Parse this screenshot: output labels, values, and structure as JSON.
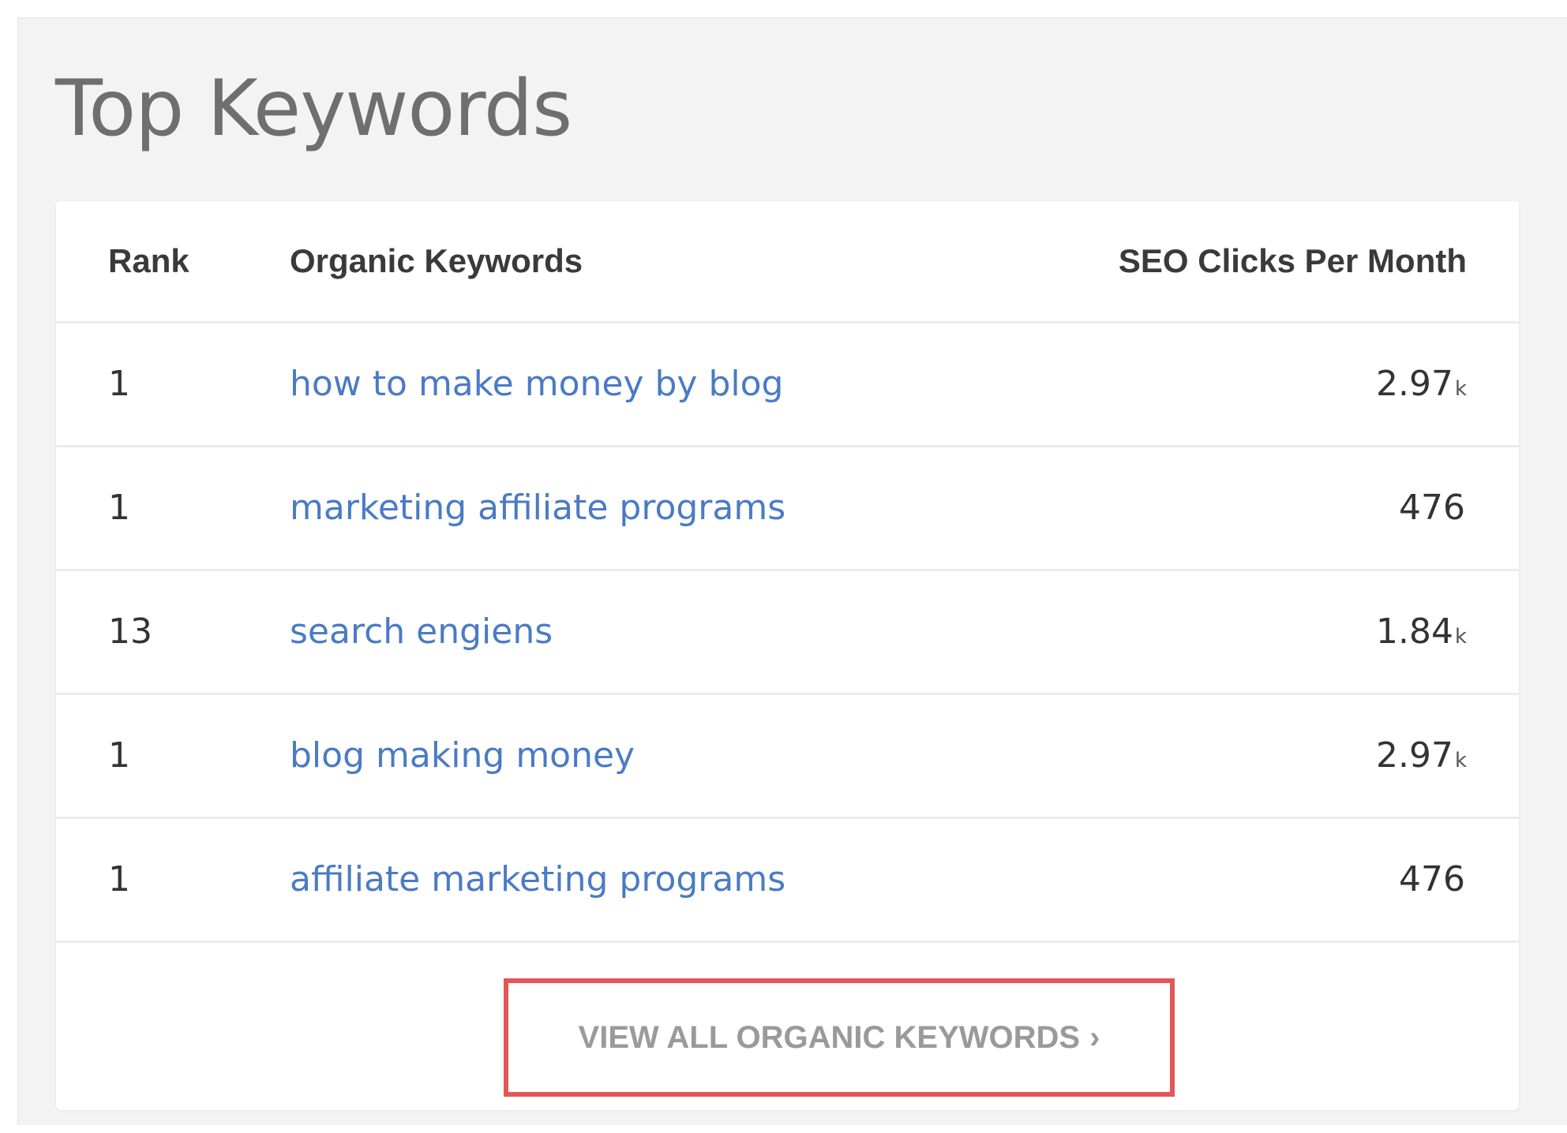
{
  "widget": {
    "title": "Top Keywords"
  },
  "table": {
    "headers": {
      "rank": "Rank",
      "keyword": "Organic Keywords",
      "clicks": "SEO Clicks Per Month"
    },
    "rows": [
      {
        "rank": "1",
        "keyword": "how to make money by blog",
        "clicks": "2.97",
        "unit": "k"
      },
      {
        "rank": "1",
        "keyword": "marketing affiliate programs",
        "clicks": "476",
        "unit": ""
      },
      {
        "rank": "13",
        "keyword": "search engiens",
        "clicks": "1.84",
        "unit": "k"
      },
      {
        "rank": "1",
        "keyword": "blog making money",
        "clicks": "2.97",
        "unit": "k"
      },
      {
        "rank": "1",
        "keyword": "affiliate marketing programs",
        "clicks": "476",
        "unit": ""
      }
    ]
  },
  "footer": {
    "view_all_label": "VIEW ALL ORGANIC KEYWORDS",
    "view_all_chevron": "›"
  },
  "colors": {
    "link": "#4a7bc4",
    "highlight_border": "#e25757",
    "panel_background": "#f3f3f3"
  }
}
